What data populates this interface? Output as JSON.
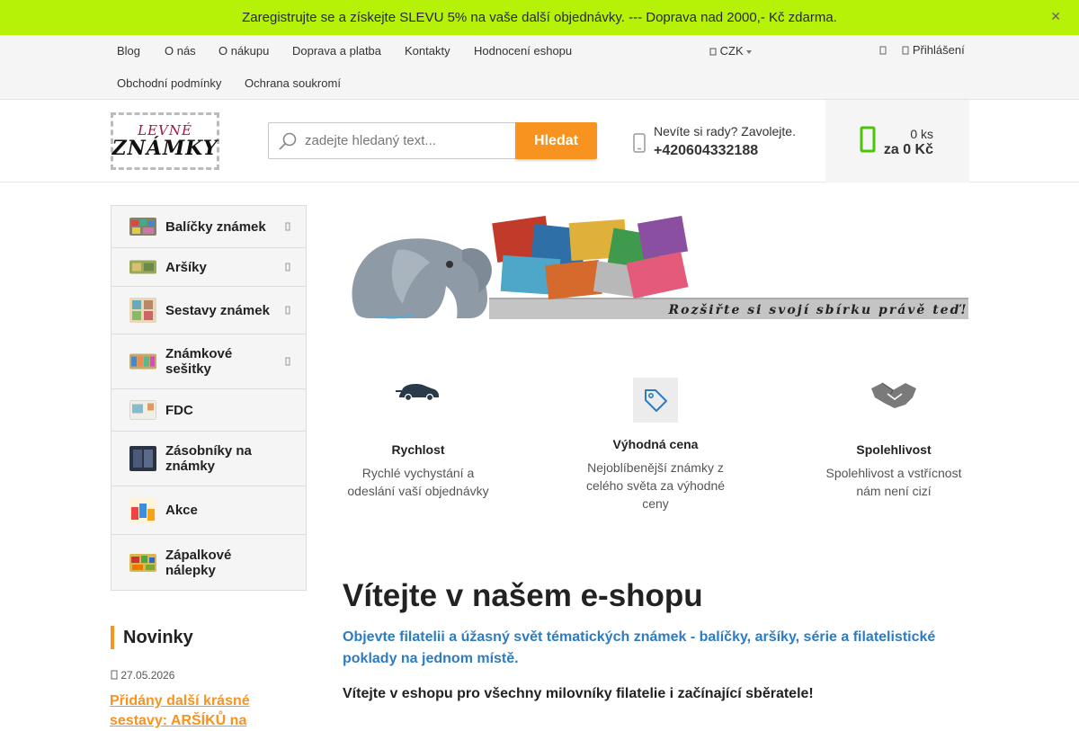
{
  "promo": {
    "text": "Zaregistrujte se a získejte SLEVU 5% na vaše další objednávky. --- Doprava nad 2000,- Kč zdarma.",
    "close_icon": "close-icon",
    "color": "#b6f208"
  },
  "topnav": {
    "items": [
      "Blog",
      "O nás",
      "O nákupu",
      "Doprava a platba",
      "Kontakty",
      "Hodnocení eshopu",
      "Obchodní podmínky",
      "Ochrana soukromí"
    ],
    "currency": "CZK",
    "login": "Přihlášení"
  },
  "header": {
    "logo_line1": "LEVNÉ",
    "logo_line2": "ZNÁMKY",
    "search_placeholder": "zadejte hledaný text...",
    "search_button": "Hledat",
    "help_text": "Nevíte si rady? Zavolejte.",
    "phone": "+420604332188",
    "cart_count": "0 ks",
    "cart_total": "za 0 Kč",
    "accent_color": "#f7931e",
    "cart_icon_color": "#4cc40a"
  },
  "sidebar": {
    "categories": [
      {
        "label": "Balíčky známek"
      },
      {
        "label": "Aršíky"
      },
      {
        "label": "Sestavy známek"
      },
      {
        "label": "Známkové sešitky"
      },
      {
        "label": "FDC"
      },
      {
        "label": "Zásobníky na známky"
      },
      {
        "label": "Akce"
      },
      {
        "label": "Zápalkové nálepky"
      }
    ]
  },
  "news": {
    "title": "Novinky",
    "date": "27.05.2026",
    "link": "Přidány další krásné sestavy: ARŠÍKŮ na"
  },
  "banner": {
    "caption": "Rozšiřte si svojí sbírku právě teď!"
  },
  "features": [
    {
      "icon": "car-icon",
      "title": "Rychlost",
      "text": "Rychlé vychystání a odeslání vaší objednávky"
    },
    {
      "icon": "tag-icon",
      "title": "Výhodná cena",
      "text": "Nejoblíbenější známky z celého světa za výhodné ceny"
    },
    {
      "icon": "handshake-icon",
      "title": "Spolehlivost",
      "text": "Spolehlivost a vstřícnost nám není cizí"
    }
  ],
  "main": {
    "welcome": "Vítejte v našem e-shopu",
    "subtitle": "Objevte filatelii a úžasný svět tématických známek - balíčky, aršíky, série a filatelistické poklady na jednom místě.",
    "intro": "Vítejte v eshopu pro všechny milovníky filatelie i začínající sběratele!",
    "subtitle_color": "#2d7cc1"
  }
}
